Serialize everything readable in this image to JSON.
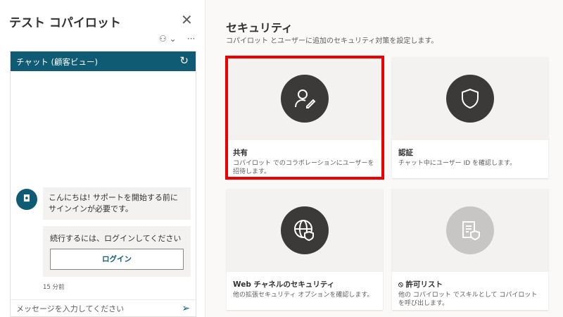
{
  "panel": {
    "title": "テスト コパイロット",
    "close": "✕",
    "bot_icon": "⚇",
    "chevron": "⌄",
    "more": "···"
  },
  "chat": {
    "header": "チャット (顧客ビュー)",
    "refresh": "↻",
    "avatar": "🤖",
    "message": "こんにちは! サポートを開始する前にサインインが必要です。",
    "card_text": "続行するには、ログインしてください",
    "login": "ログイン",
    "time": "15 分前",
    "placeholder": "メッセージを入力してください",
    "send": "➢"
  },
  "main": {
    "title": "セキュリティ",
    "subtitle": "コパイロット とユーザーに追加のセキュリティ対策を設定します。",
    "tiles": [
      {
        "title": "共有",
        "desc": "コパイロット でのコラボレーションにユーザーを招待します。",
        "icon": "share-user-icon"
      },
      {
        "title": "認証",
        "desc": "チャット中にユーザー ID を確認します。",
        "icon": "shield-icon"
      },
      {
        "title": "Web チャネルのセキュリティ",
        "desc": "他の拡張セキュリティ オプションを確認します。",
        "icon": "globe-shield-icon"
      },
      {
        "title": "許可リスト",
        "desc": "他の コパイロット でスキルとして コパイロット を呼び出します。",
        "icon": "allowlist-icon",
        "prefix": "⃠"
      }
    ]
  }
}
